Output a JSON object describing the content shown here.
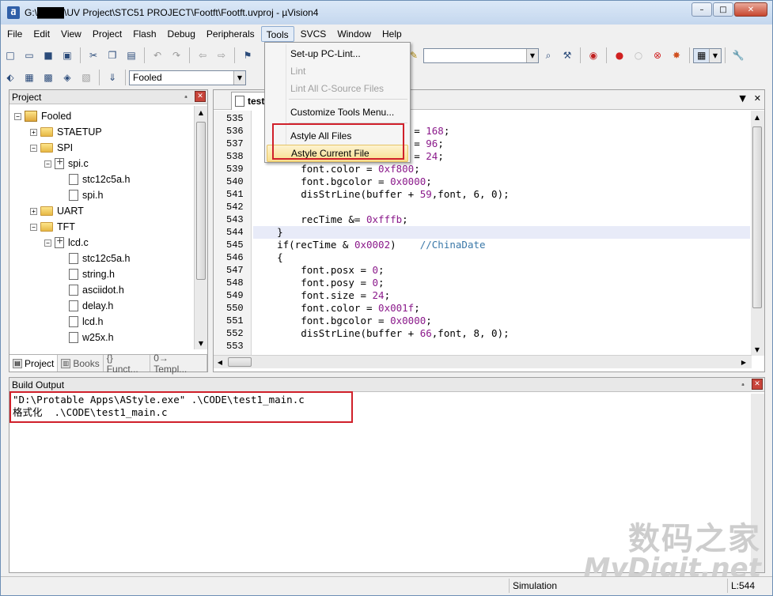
{
  "window": {
    "title": "G:\\████\\UV Project\\STC51 PROJECT\\Footft\\Footft.uvproj - µVision4",
    "icon": "ƌ",
    "minimize": "–",
    "maximize": "□",
    "close": "✕"
  },
  "menubar": [
    "File",
    "Edit",
    "View",
    "Project",
    "Flash",
    "Debug",
    "Peripherals",
    "Tools",
    "SVCS",
    "Window",
    "Help"
  ],
  "toolbar": {
    "target_combo": "Fooled"
  },
  "tools_menu": {
    "items": [
      {
        "label": "Set-up PC-Lint...",
        "disabled": false
      },
      {
        "label": "Lint",
        "disabled": true
      },
      {
        "label": "Lint All C-Source Files",
        "disabled": true
      },
      {
        "label": "Customize Tools Menu...",
        "disabled": false
      },
      {
        "label": "Astyle All Files",
        "disabled": false
      },
      {
        "label": "Astyle Current File",
        "disabled": false,
        "highlighted": true
      }
    ]
  },
  "project_panel": {
    "title": "Project",
    "pin": "ₐ",
    "close": "✕",
    "tree": [
      {
        "label": "Fooled",
        "level": 0,
        "type": "project",
        "expander": "−"
      },
      {
        "label": "STAETUP",
        "level": 1,
        "type": "folder",
        "expander": "+"
      },
      {
        "label": "SPI",
        "level": 1,
        "type": "folder",
        "expander": "−"
      },
      {
        "label": "spi.c",
        "level": 2,
        "type": "cfile",
        "expander": "−"
      },
      {
        "label": "stc12c5a.h",
        "level": 3,
        "type": "hfile"
      },
      {
        "label": "spi.h",
        "level": 3,
        "type": "hfile"
      },
      {
        "label": "UART",
        "level": 1,
        "type": "folder",
        "expander": "+"
      },
      {
        "label": "TFT",
        "level": 1,
        "type": "folder",
        "expander": "−"
      },
      {
        "label": "lcd.c",
        "level": 2,
        "type": "cfile",
        "expander": "−"
      },
      {
        "label": "stc12c5a.h",
        "level": 3,
        "type": "hfile"
      },
      {
        "label": "string.h",
        "level": 3,
        "type": "hfile"
      },
      {
        "label": "asciidot.h",
        "level": 3,
        "type": "hfile"
      },
      {
        "label": "delay.h",
        "level": 3,
        "type": "hfile"
      },
      {
        "label": "lcd.h",
        "level": 3,
        "type": "hfile"
      },
      {
        "label": "w25x.h",
        "level": 3,
        "type": "hfile"
      }
    ],
    "tabs": [
      "Project",
      "Books",
      "{} Funct...",
      "0→ Templ..."
    ]
  },
  "editor": {
    "tab_label": "test",
    "lines": [
      {
        "n": "535",
        "text": ""
      },
      {
        "n": "536",
        "pre": "                           ",
        "code": "= ",
        "num": "168",
        "post": ";"
      },
      {
        "n": "537",
        "pre": "                           ",
        "code": "= ",
        "num": "96",
        "post": ";"
      },
      {
        "n": "538",
        "pre": "                           ",
        "code": "= ",
        "num": "24",
        "post": ";"
      },
      {
        "n": "539",
        "pre": "        ",
        "code": "font.color = ",
        "num": "0xf800",
        "post": ";"
      },
      {
        "n": "540",
        "pre": "        ",
        "code": "font.bgcolor = ",
        "num": "0x0000",
        "post": ";"
      },
      {
        "n": "541",
        "pre": "        ",
        "code": "disStrLine(buffer + ",
        "num": "59",
        "post": ",font, 6, 0);"
      },
      {
        "n": "542",
        "text": ""
      },
      {
        "n": "543",
        "pre": "        ",
        "code": "recTime &= ",
        "num": "0xfffb",
        "post": ";"
      },
      {
        "n": "544",
        "pre": "    ",
        "code": "}",
        "hl": true
      },
      {
        "n": "545",
        "pre": "    ",
        "code": "if(recTime & ",
        "num": "0x0002",
        "post": ")    ",
        "cmt": "//ChinaDate"
      },
      {
        "n": "546",
        "pre": "    ",
        "code": "{"
      },
      {
        "n": "547",
        "pre": "        ",
        "code": "font.posx = ",
        "num": "0",
        "post": ";"
      },
      {
        "n": "548",
        "pre": "        ",
        "code": "font.posy = ",
        "num": "0",
        "post": ";"
      },
      {
        "n": "549",
        "pre": "        ",
        "code": "font.size = ",
        "num": "24",
        "post": ";"
      },
      {
        "n": "550",
        "pre": "        ",
        "code": "font.color = ",
        "num": "0x001f",
        "post": ";"
      },
      {
        "n": "551",
        "pre": "        ",
        "code": "font.bgcolor = ",
        "num": "0x0000",
        "post": ";"
      },
      {
        "n": "552",
        "pre": "        ",
        "code": "disStrLine(buffer + ",
        "num": "66",
        "post": ",font, 8, 0);"
      },
      {
        "n": "553",
        "text": ""
      }
    ]
  },
  "build_output": {
    "title": "Build Output",
    "lines": [
      "\"D:\\Protable Apps\\AStyle.exe\" .\\CODE\\test1_main.c",
      "格式化  .\\CODE\\test1_main.c"
    ]
  },
  "statusbar": {
    "mode": "Simulation",
    "line": "L:544"
  },
  "watermark": {
    "cn": "数码之家",
    "en": "MyDigit.net"
  },
  "colors": {
    "highlight_box": "#d0202a",
    "number_literal": "#8b1a8b",
    "comment": "#3a78a8"
  }
}
